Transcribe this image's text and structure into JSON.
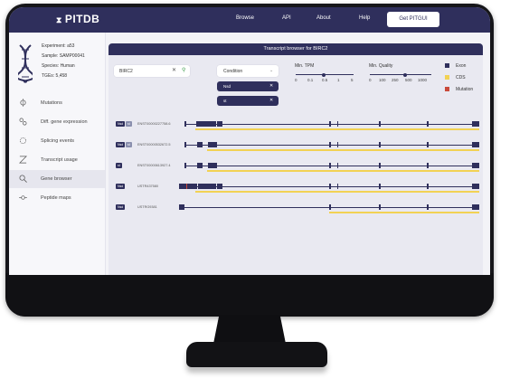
{
  "app": {
    "logo": "PITDB",
    "nav": [
      "Browse",
      "API",
      "About",
      "Help"
    ],
    "cta": "Get PITGUI"
  },
  "sidebar": {
    "experiment": "Experiment: a53",
    "sample": "Sample: SAMP00041",
    "species": "Species: Human",
    "toes": "TGEs: 5,458",
    "items": [
      {
        "label": "Mutations",
        "icon": "mutation-icon"
      },
      {
        "label": "Diff. gene expression",
        "icon": "expression-icon"
      },
      {
        "label": "Splicing events",
        "icon": "splicing-icon"
      },
      {
        "label": "Transcript usage",
        "icon": "transcript-usage-icon"
      },
      {
        "label": "Gene browser",
        "icon": "gene-browser-icon",
        "active": true
      },
      {
        "label": "Peptide maps",
        "icon": "peptide-icon"
      }
    ]
  },
  "panel": {
    "title": "Transcript browser for BIRC2",
    "search": {
      "value": "BIRC2"
    },
    "condition": {
      "label": "Condition",
      "chips": [
        "Nsd",
        "st"
      ]
    },
    "tpm": {
      "title": "Min. TPM",
      "ticks": [
        "0",
        "0.1",
        "0.5",
        "1",
        "5"
      ],
      "selected": 0.45
    },
    "quality": {
      "title": "Min. Quality",
      "ticks": [
        "0",
        "100",
        "250",
        "500",
        "1000"
      ],
      "selected": 0.55
    },
    "legend": [
      {
        "label": "Exon",
        "color": "#2f2f5c"
      },
      {
        "label": "CDS",
        "color": "#f2d254"
      },
      {
        "label": "Mutation",
        "color": "#c94a3a"
      }
    ],
    "transcripts": [
      {
        "badges": [
          "Nsd",
          "st"
        ],
        "name": "ENST00000227758.6"
      },
      {
        "badges": [
          "Nsd",
          "st"
        ],
        "name": "ENST00000532672.5"
      },
      {
        "badges": [
          "st"
        ],
        "name": "ENST00000613927.4"
      },
      {
        "badges": [
          "Nsd"
        ],
        "name": "USTR437580"
      },
      {
        "badges": [
          "Nsd"
        ],
        "name": "USTRG9381"
      }
    ]
  }
}
